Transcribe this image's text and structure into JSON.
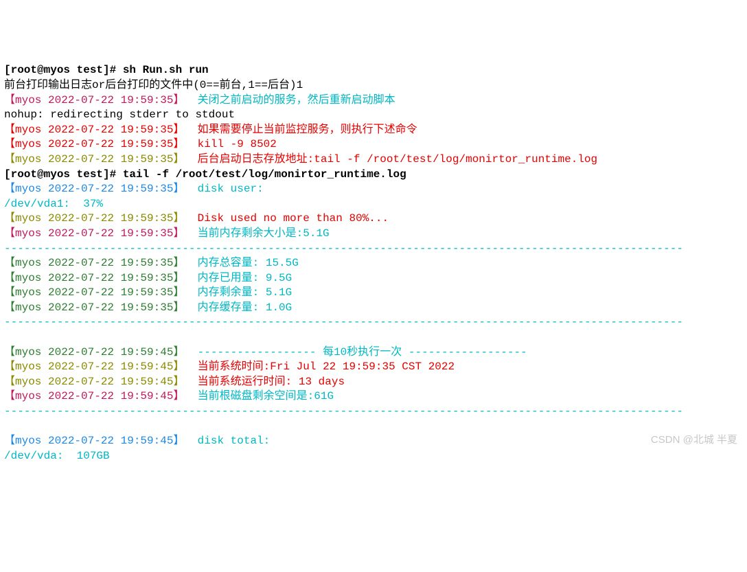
{
  "lines": [
    {
      "parts": [
        {
          "text": "[root@myos test]# sh Run.sh run",
          "cls": "black bold"
        }
      ]
    },
    {
      "parts": [
        {
          "text": "前台打印输出日志or后台打印的文件中(0==前台,1==后台)1",
          "cls": "black"
        }
      ]
    },
    {
      "parts": [
        {
          "text": "【myos 2022-07-22 19:59:35】 ",
          "cls": "magenta"
        },
        {
          "text": " 关闭之前启动的服务，然后重新启动脚本",
          "cls": "cyan"
        }
      ]
    },
    {
      "parts": [
        {
          "text": "nohup: redirecting stderr to stdout",
          "cls": "black"
        }
      ]
    },
    {
      "parts": [
        {
          "text": "【myos 2022-07-22 19:59:35】 ",
          "cls": "red"
        },
        {
          "text": " 如果需要停止当前监控服务，则执行下述命令",
          "cls": "red"
        }
      ]
    },
    {
      "parts": [
        {
          "text": "【myos 2022-07-22 19:59:35】 ",
          "cls": "red"
        },
        {
          "text": " kill -9 8502",
          "cls": "red"
        }
      ]
    },
    {
      "parts": [
        {
          "text": "【myos 2022-07-22 19:59:35】 ",
          "cls": "olive"
        },
        {
          "text": " 后台启动日志存放地址:tail -f /root/test/log/monirtor_runtime.log",
          "cls": "red"
        }
      ]
    },
    {
      "parts": [
        {
          "text": "[root@myos test]# tail -f /root/test/log/monirtor_runtime.log",
          "cls": "black bold"
        }
      ]
    },
    {
      "parts": [
        {
          "text": "【myos 2022-07-22 19:59:35】 ",
          "cls": "blue"
        },
        {
          "text": " disk user:",
          "cls": "cyan"
        }
      ]
    },
    {
      "parts": [
        {
          "text": "/dev/vda1:  37%",
          "cls": "cyan"
        }
      ]
    },
    {
      "parts": [
        {
          "text": "【myos 2022-07-22 19:59:35】 ",
          "cls": "olive"
        },
        {
          "text": " Disk used no more than 80%...",
          "cls": "red"
        }
      ]
    },
    {
      "parts": [
        {
          "text": "【myos 2022-07-22 19:59:35】 ",
          "cls": "magenta"
        },
        {
          "text": " 当前内存剩余大小是:5.1G",
          "cls": "cyan"
        }
      ]
    },
    {
      "parts": [
        {
          "text": "-------------------------------------------------------------------------------------------------------",
          "cls": "cyan"
        }
      ]
    },
    {
      "parts": [
        {
          "text": "【myos 2022-07-22 19:59:35】 ",
          "cls": "darkgreen"
        },
        {
          "text": " 内存总容量: 15.5G",
          "cls": "cyan"
        }
      ]
    },
    {
      "parts": [
        {
          "text": "【myos 2022-07-22 19:59:35】 ",
          "cls": "darkgreen"
        },
        {
          "text": " 内存已用量: 9.5G",
          "cls": "cyan"
        }
      ]
    },
    {
      "parts": [
        {
          "text": "【myos 2022-07-22 19:59:35】 ",
          "cls": "darkgreen"
        },
        {
          "text": " 内存剩余量: 5.1G",
          "cls": "cyan"
        }
      ]
    },
    {
      "parts": [
        {
          "text": "【myos 2022-07-22 19:59:35】 ",
          "cls": "darkgreen"
        },
        {
          "text": " 内存缓存量: 1.0G",
          "cls": "cyan"
        }
      ]
    },
    {
      "parts": [
        {
          "text": "-------------------------------------------------------------------------------------------------------",
          "cls": "cyan"
        }
      ]
    },
    {
      "parts": [
        {
          "text": " ",
          "cls": ""
        }
      ]
    },
    {
      "parts": [
        {
          "text": "【myos 2022-07-22 19:59:45】 ",
          "cls": "darkgreen"
        },
        {
          "text": " ------------------ 每10秒执行一次 ------------------",
          "cls": "cyan"
        }
      ]
    },
    {
      "parts": [
        {
          "text": "【myos 2022-07-22 19:59:45】 ",
          "cls": "olive"
        },
        {
          "text": " 当前系统时间:Fri Jul 22 19:59:35 CST 2022",
          "cls": "red"
        }
      ]
    },
    {
      "parts": [
        {
          "text": "【myos 2022-07-22 19:59:45】 ",
          "cls": "olive"
        },
        {
          "text": " 当前系统运行时间: 13 days",
          "cls": "red"
        }
      ]
    },
    {
      "parts": [
        {
          "text": "【myos 2022-07-22 19:59:45】 ",
          "cls": "magenta"
        },
        {
          "text": " 当前根磁盘剩余空间是:61G",
          "cls": "cyan"
        }
      ]
    },
    {
      "parts": [
        {
          "text": "-------------------------------------------------------------------------------------------------------",
          "cls": "cyan"
        }
      ]
    },
    {
      "parts": [
        {
          "text": " ",
          "cls": ""
        }
      ]
    },
    {
      "parts": [
        {
          "text": "【myos 2022-07-22 19:59:45】 ",
          "cls": "blue"
        },
        {
          "text": " disk total:",
          "cls": "cyan"
        }
      ]
    },
    {
      "parts": [
        {
          "text": "/dev/vda:  107GB",
          "cls": "cyan"
        }
      ]
    }
  ],
  "watermark": "CSDN @北城 半夏"
}
